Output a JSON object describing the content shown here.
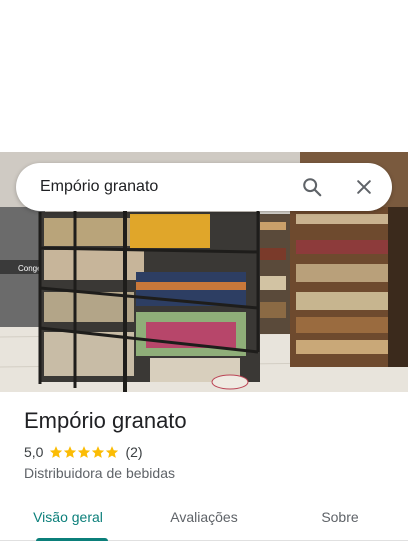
{
  "search": {
    "query": "Empório granato"
  },
  "place": {
    "name": "Empório granato",
    "rating": "5,0",
    "stars": 5,
    "review_count": "(2)",
    "category": "Distribuidora de bebidas"
  },
  "tabs": [
    {
      "label": "Visão geral",
      "active": true
    },
    {
      "label": "Avaliações",
      "active": false
    },
    {
      "label": "Sobre",
      "active": false
    }
  ],
  "photo": {
    "sign_text": "Congelado"
  },
  "colors": {
    "accent": "#0b7f7a",
    "star": "#fbbc04"
  }
}
